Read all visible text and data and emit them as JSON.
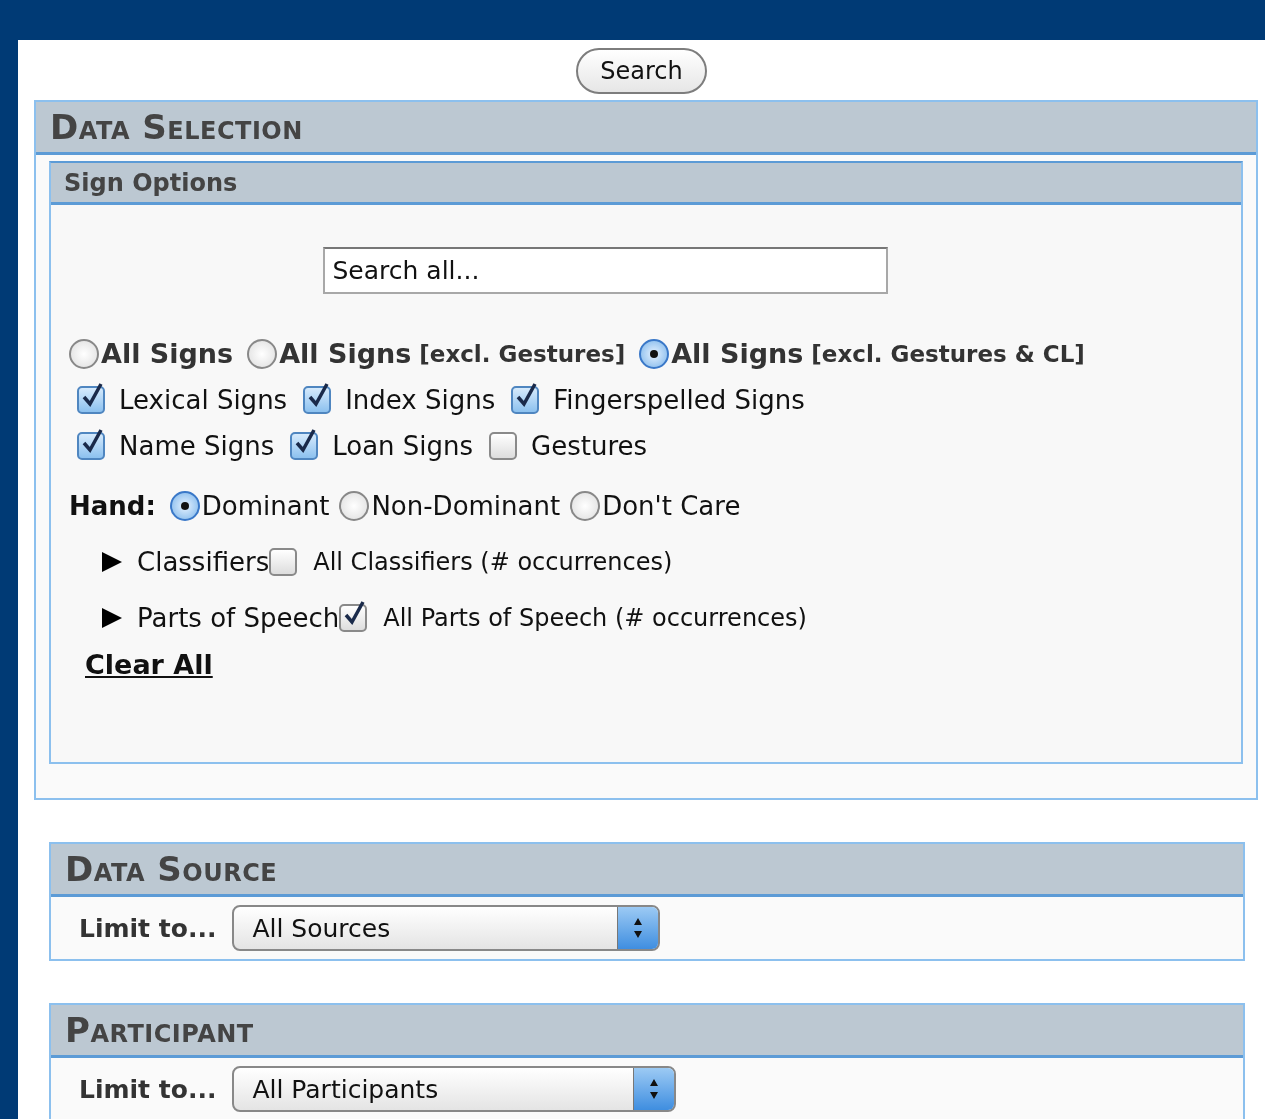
{
  "search_button": {
    "label": "Search"
  },
  "data_selection": {
    "title": "Data Selection",
    "sign_options": {
      "title": "Sign Options",
      "search": {
        "placeholder": "Search all..."
      },
      "scope": [
        {
          "label": "All Signs",
          "selected": false
        },
        {
          "label": "All Signs",
          "note": "[excl. Gestures]",
          "selected": false
        },
        {
          "label": "All Signs",
          "note": "[excl. Gestures & CL]",
          "selected": true
        }
      ],
      "sign_type_rows": [
        {
          "items": [
            {
              "label": "Lexical Signs",
              "checked": true
            },
            {
              "label": "Index Signs",
              "checked": true
            },
            {
              "label": "Fingerspelled Signs",
              "checked": true
            }
          ]
        },
        {
          "items": [
            {
              "label": "Name Signs",
              "checked": true
            },
            {
              "label": "Loan Signs",
              "checked": true
            },
            {
              "label": "Gestures",
              "checked": false
            }
          ]
        }
      ],
      "hand": {
        "label": "Hand:",
        "options": [
          {
            "label": "Dominant",
            "selected": true
          },
          {
            "label": "Non-Dominant",
            "selected": false
          },
          {
            "label": "Don't Care",
            "selected": false
          }
        ]
      },
      "filters": [
        {
          "label": "Classifiers",
          "expanded": false,
          "all_label": "All Classifiers (# occurrences)",
          "checked": false
        },
        {
          "label": "Parts of Speech",
          "expanded": false,
          "all_label": "All Parts of Speech (# occurrences)",
          "checked": true
        }
      ],
      "clear_all": "Clear All"
    }
  },
  "data_source": {
    "title": "Data Source",
    "limit_label": "Limit to...",
    "value": "All Sources"
  },
  "participant": {
    "title": "Participant",
    "limit_label": "Limit to...",
    "value": "All Participants"
  }
}
